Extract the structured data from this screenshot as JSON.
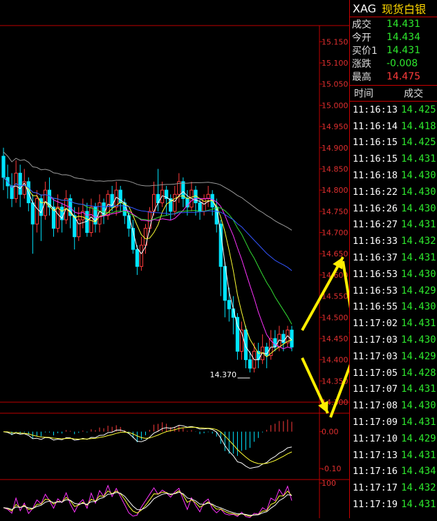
{
  "quote": {
    "code": "XAG",
    "name": "现货白银",
    "fields": [
      {
        "label": "成交",
        "value": "14.431",
        "color": "green"
      },
      {
        "label": "今开",
        "value": "14.434",
        "color": "green"
      },
      {
        "label": "买价1",
        "value": "14.431",
        "color": "green"
      },
      {
        "label": "涨跌",
        "value": "-0.008",
        "color": "green"
      },
      {
        "label": "最高",
        "value": "14.475",
        "color": "red"
      }
    ]
  },
  "ticks": {
    "header_time": "时间",
    "header_price": "成交",
    "rows": [
      {
        "time": "11:16:13",
        "price": "14.425"
      },
      {
        "time": "11:16:14",
        "price": "14.418"
      },
      {
        "time": "11:16:15",
        "price": "14.425"
      },
      {
        "time": "11:16:15",
        "price": "14.431"
      },
      {
        "time": "11:16:18",
        "price": "14.430"
      },
      {
        "time": "11:16:22",
        "price": "14.430"
      },
      {
        "time": "11:16:26",
        "price": "14.430"
      },
      {
        "time": "11:16:27",
        "price": "14.431"
      },
      {
        "time": "11:16:33",
        "price": "14.432"
      },
      {
        "time": "11:16:37",
        "price": "14.431"
      },
      {
        "time": "11:16:53",
        "price": "14.430"
      },
      {
        "time": "11:16:53",
        "price": "14.429"
      },
      {
        "time": "11:16:55",
        "price": "14.430"
      },
      {
        "time": "11:17:02",
        "price": "14.431"
      },
      {
        "time": "11:17:03",
        "price": "14.430"
      },
      {
        "time": "11:17:03",
        "price": "14.429"
      },
      {
        "time": "11:17:05",
        "price": "14.428"
      },
      {
        "time": "11:17:07",
        "price": "14.431"
      },
      {
        "time": "11:17:08",
        "price": "14.430"
      },
      {
        "time": "11:17:09",
        "price": "14.431"
      },
      {
        "time": "11:17:10",
        "price": "14.429"
      },
      {
        "time": "11:17:13",
        "price": "14.431"
      },
      {
        "time": "11:17:16",
        "price": "14.434"
      },
      {
        "time": "11:17:17",
        "price": "14.432"
      },
      {
        "time": "11:17:19",
        "price": "14.431"
      }
    ]
  },
  "chart_data": [
    {
      "type": "candlestick",
      "ylim": [
        14.3,
        15.175
      ],
      "yticks": [
        "15.150",
        "15.100",
        "15.050",
        "15.000",
        "14.950",
        "14.900",
        "14.850",
        "14.800",
        "14.750",
        "14.700",
        "14.650",
        "14.600",
        "14.550",
        "14.500",
        "14.450",
        "14.400",
        "14.350",
        "14.300"
      ],
      "low_annotation": "14.370",
      "candles": [
        [
          14.88,
          14.83,
          14.9,
          14.8
        ],
        [
          14.83,
          14.81,
          14.86,
          14.78
        ],
        [
          14.81,
          14.78,
          14.84,
          14.76
        ],
        [
          14.78,
          14.84,
          14.87,
          14.77
        ],
        [
          14.84,
          14.79,
          14.86,
          14.76
        ],
        [
          14.79,
          14.82,
          14.85,
          14.78
        ],
        [
          14.82,
          14.77,
          14.83,
          14.75
        ],
        [
          14.77,
          14.72,
          14.79,
          14.65
        ],
        [
          14.72,
          14.78,
          14.8,
          14.7
        ],
        [
          14.78,
          14.74,
          14.79,
          14.68
        ],
        [
          14.74,
          14.8,
          14.82,
          14.73
        ],
        [
          14.8,
          14.76,
          14.83,
          14.74
        ],
        [
          14.76,
          14.71,
          14.78,
          14.69
        ],
        [
          14.71,
          14.76,
          14.79,
          14.7
        ],
        [
          14.76,
          14.73,
          14.77,
          14.7
        ],
        [
          14.73,
          14.78,
          14.8,
          14.72
        ],
        [
          14.78,
          14.74,
          14.79,
          14.71
        ],
        [
          14.74,
          14.69,
          14.76,
          14.66
        ],
        [
          14.69,
          14.73,
          14.76,
          14.68
        ],
        [
          14.73,
          14.75,
          14.78,
          14.71
        ],
        [
          14.75,
          14.7,
          14.77,
          14.69
        ],
        [
          14.7,
          14.76,
          14.78,
          14.69
        ],
        [
          14.76,
          14.72,
          14.77,
          14.7
        ],
        [
          14.72,
          14.77,
          14.79,
          14.7
        ],
        [
          14.77,
          14.74,
          14.78,
          14.72
        ],
        [
          14.74,
          14.79,
          14.8,
          14.73
        ],
        [
          14.79,
          14.76,
          14.81,
          14.75
        ],
        [
          14.76,
          14.8,
          14.82,
          14.74
        ],
        [
          14.8,
          14.77,
          14.81,
          14.75
        ],
        [
          14.77,
          14.74,
          14.78,
          14.72
        ],
        [
          14.74,
          14.71,
          14.75,
          14.69
        ],
        [
          14.71,
          14.66,
          14.73,
          14.65
        ],
        [
          14.66,
          14.62,
          14.67,
          14.6
        ],
        [
          14.62,
          14.67,
          14.69,
          14.61
        ],
        [
          14.67,
          14.71,
          14.72,
          14.65
        ],
        [
          14.71,
          14.75,
          14.76,
          14.7
        ],
        [
          14.75,
          14.79,
          14.82,
          14.74
        ],
        [
          14.79,
          14.77,
          14.85,
          14.75
        ],
        [
          14.77,
          14.8,
          14.82,
          14.76
        ],
        [
          14.8,
          14.78,
          14.81,
          14.74
        ],
        [
          14.78,
          14.75,
          14.79,
          14.73
        ],
        [
          14.75,
          14.79,
          14.81,
          14.74
        ],
        [
          14.79,
          14.82,
          14.84,
          14.77
        ],
        [
          14.82,
          14.78,
          14.83,
          14.76
        ],
        [
          14.78,
          14.76,
          14.8,
          14.74
        ],
        [
          14.76,
          14.8,
          14.82,
          14.75
        ],
        [
          14.8,
          14.77,
          14.81,
          14.74
        ],
        [
          14.77,
          14.75,
          14.78,
          14.73
        ],
        [
          14.75,
          14.78,
          14.79,
          14.74
        ],
        [
          14.78,
          14.79,
          14.81,
          14.76
        ],
        [
          14.79,
          14.76,
          14.8,
          14.74
        ],
        [
          14.76,
          14.72,
          14.78,
          14.7
        ],
        [
          14.72,
          14.62,
          14.73,
          14.55
        ],
        [
          14.62,
          14.54,
          14.63,
          14.5
        ],
        [
          14.54,
          14.52,
          14.57,
          14.49
        ],
        [
          14.52,
          14.5,
          14.55,
          14.46
        ],
        [
          14.5,
          14.42,
          14.51,
          14.4
        ],
        [
          14.42,
          14.47,
          14.49,
          14.4
        ],
        [
          14.47,
          14.4,
          14.48,
          14.38
        ],
        [
          14.4,
          14.38,
          14.42,
          14.37
        ],
        [
          14.38,
          14.42,
          14.44,
          14.37
        ],
        [
          14.42,
          14.4,
          14.44,
          14.38
        ],
        [
          14.4,
          14.43,
          14.46,
          14.39
        ],
        [
          14.43,
          14.41,
          14.44,
          14.38
        ],
        [
          14.41,
          14.45,
          14.47,
          14.4
        ],
        [
          14.45,
          14.43,
          14.47,
          14.42
        ],
        [
          14.43,
          14.46,
          14.48,
          14.42
        ],
        [
          14.46,
          14.44,
          14.47,
          14.42
        ],
        [
          14.44,
          14.47,
          14.48,
          14.43
        ],
        [
          14.47,
          14.43,
          14.48,
          14.42
        ]
      ]
    },
    {
      "type": "macd",
      "yticks": [
        "0.00",
        "-0.10"
      ],
      "ylim": [
        -0.13,
        0.05
      ]
    },
    {
      "type": "oscillator",
      "yticks": [
        "100"
      ],
      "ylim": [
        0,
        110
      ]
    }
  ],
  "colors": {
    "up": "#ff3b3b",
    "down": "#00e5ff",
    "grid": "#c00000",
    "axis_text": "#e03030"
  }
}
